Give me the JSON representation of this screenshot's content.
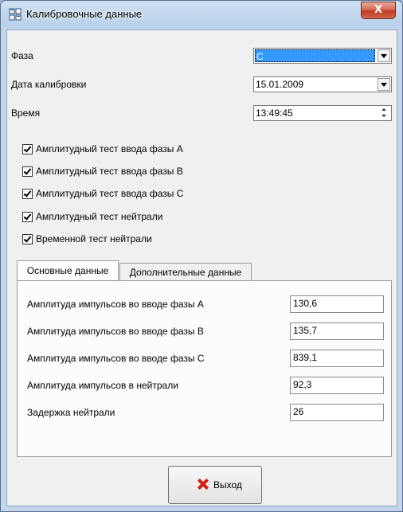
{
  "window": {
    "title": "Калибровочные данные",
    "close_glyph": "X"
  },
  "phase": {
    "label": "Фаза",
    "value": "C"
  },
  "calibration_date": {
    "label": "Дата калибровки",
    "value": "15.01.2009"
  },
  "time": {
    "label": "Время",
    "value": "13:49:45"
  },
  "tests": [
    {
      "label": "Амплитудный тест ввода фазы А",
      "checked": true
    },
    {
      "label": "Амплитудный тест ввода фазы В",
      "checked": true
    },
    {
      "label": "Амплитудный тест ввода фазы С",
      "checked": true
    },
    {
      "label": "Амплитудный тест нейтрали",
      "checked": true
    },
    {
      "label": "Временной тест нейтрали",
      "checked": true
    }
  ],
  "tabs": [
    {
      "label": "Основные данные",
      "active": true
    },
    {
      "label": "Дополнительные данные",
      "active": false
    }
  ],
  "main_data": [
    {
      "label": "Амплитуда импульсов во вводе фазы А",
      "value": "130,6"
    },
    {
      "label": "Амплитуда импульсов во вводе фазы В",
      "value": "135,7"
    },
    {
      "label": "Амплитуда импульсов во вводе фазы С",
      "value": "839,1"
    },
    {
      "label": "Амплитуда импульсов в нейтрали",
      "value": "92,3"
    },
    {
      "label": "Задержка нейтрали",
      "value": "26"
    }
  ],
  "exit_button": {
    "label": "Выход",
    "icon": "red-x-icon"
  },
  "colors": {
    "selection": "#3399ff",
    "close_button": "#c0391f",
    "exit_icon": "#d21f12"
  }
}
